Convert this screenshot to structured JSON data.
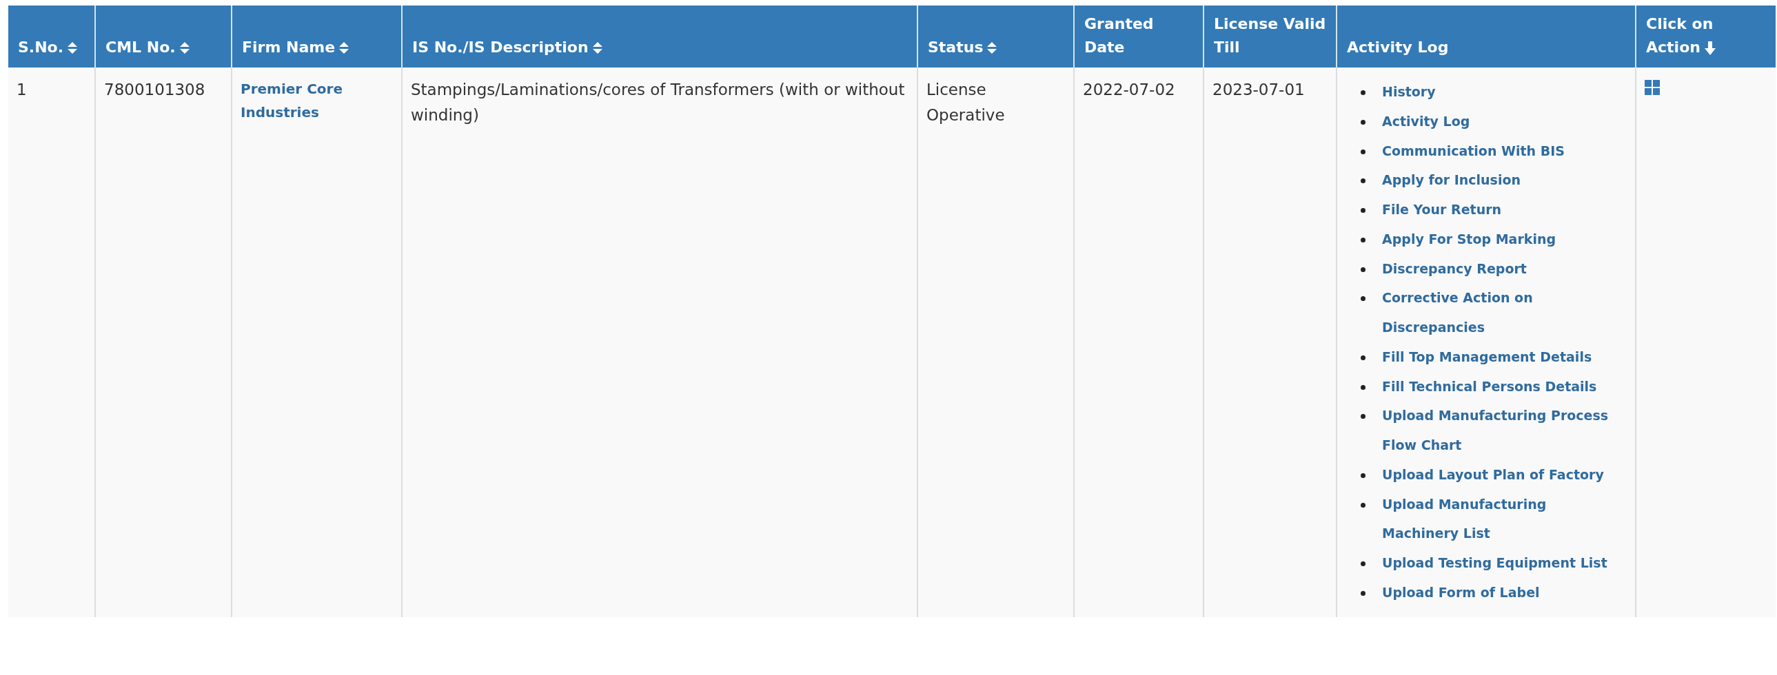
{
  "table": {
    "columns": [
      {
        "label": "S.No.",
        "kind": "sortable"
      },
      {
        "label": "CML No.",
        "kind": "sortable"
      },
      {
        "label": "Firm Name",
        "kind": "sortable"
      },
      {
        "label": "IS No./IS Description",
        "kind": "sortable"
      },
      {
        "label": "Status",
        "kind": "sortable"
      },
      {
        "label": "Granted Date",
        "kind": "plain"
      },
      {
        "label": "License Valid Till",
        "kind": "plain"
      },
      {
        "label": "Activity Log",
        "kind": "plain"
      },
      {
        "label": "Click on Action",
        "kind": "sorted-down"
      }
    ],
    "rows": [
      {
        "cells": [
          {
            "kind": "text",
            "text": "1"
          },
          {
            "kind": "text",
            "text": "7800101308"
          },
          {
            "kind": "link",
            "text": "Premier Core Industries"
          },
          {
            "kind": "text",
            "text": "Stampings/Laminations/cores of Transformers (with or without winding)"
          },
          {
            "kind": "text",
            "text": "License Operative"
          },
          {
            "kind": "text",
            "text": "2022-07-02"
          },
          {
            "kind": "text",
            "text": "2023-07-01"
          },
          {
            "kind": "links",
            "items": [
              "History",
              "Activity Log",
              "Communication With BIS",
              "Apply for Inclusion",
              "File Your Return",
              "Apply For Stop Marking",
              "Discrepancy Report",
              "Corrective Action on Discrepancies",
              "Fill Top Management Details",
              "Fill Technical Persons Details",
              "Upload Manufacturing Process Flow Chart",
              "Upload Layout Plan of Factory",
              "Upload Manufacturing Machinery List",
              "Upload Testing Equipment List",
              "Upload Form of Label"
            ]
          },
          {
            "kind": "action"
          }
        ]
      }
    ]
  }
}
